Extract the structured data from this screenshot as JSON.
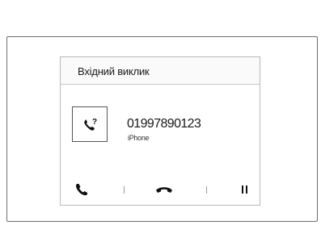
{
  "dialog": {
    "title": "Вхідний виклик",
    "caller_icon": "incoming-call-unknown-icon",
    "number": "01997890123",
    "device": "iPhone"
  },
  "actions": [
    {
      "name": "answer",
      "icon": "phone-answer-icon"
    },
    {
      "name": "decline",
      "icon": "phone-hangup-icon"
    },
    {
      "name": "hold",
      "icon": "pause-icon"
    }
  ],
  "colors": {
    "frame": "#6e6e6e",
    "text": "#1a1a1a",
    "icon": "#111111"
  }
}
